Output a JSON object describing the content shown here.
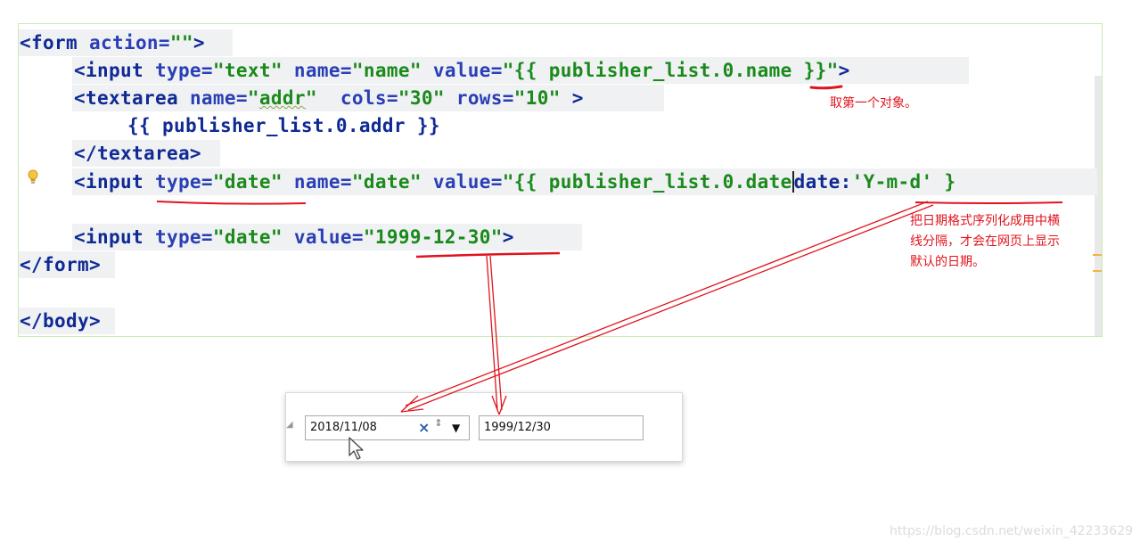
{
  "code": {
    "line1": {
      "open": "<form ",
      "attr": "action=",
      "val": "\"\"",
      "close": ">"
    },
    "line2": {
      "open": "<input ",
      "a1": "type=",
      "v1": "\"text\"",
      "a2": " name=",
      "v2": "\"name\"",
      "a3": " value=",
      "v3": "\"{{ publisher_list.0.name }}\"",
      "close": ">"
    },
    "line3": {
      "open": "<textarea ",
      "a1": "name=",
      "v1q1": "\"",
      "v1": "addr",
      "v1q2": "\"",
      "a2": "  cols=",
      "v2": "\"30\"",
      "a3": " rows=",
      "v3": "\"10\"",
      "close": " >"
    },
    "line4": {
      "text": "{{ publisher_list.0.addr }}"
    },
    "line5": {
      "text": "</textarea>"
    },
    "line6": {
      "open": "<input ",
      "a1": "type=",
      "v1": "\"date\"",
      "a2": " name=",
      "v2": "\"date\"",
      "a3": " value=",
      "v3a": "\"{{ publisher_list.0.date",
      "v3b": "date:",
      "v3c": "'Y-m-d'",
      "tail": " }"
    },
    "line7": {
      "open": "<input ",
      "a1": "type=",
      "v1": "\"date\"",
      "a2": " value=",
      "v2": "\"1999-12-30\"",
      "close": ">"
    },
    "line8": {
      "text": "</form>"
    },
    "line9": {
      "text": "</body>"
    }
  },
  "annotations": {
    "first_object": "取第一个对象。",
    "date_format_1": "把日期格式序列化成用中横",
    "date_format_2": "线分隔，才会在网页上显示",
    "date_format_3": "默认的日期。"
  },
  "rendered_inputs": {
    "date1_value": "2018/11/08",
    "clear_icon": "×",
    "spin_icon": "⇕",
    "drop_icon": "▼",
    "date2_value": "1999/12/30"
  },
  "watermark": "https://blog.csdn.net/weixin_42233629",
  "colors": {
    "annotation_red": "#e0141e",
    "tag_blue": "#0c1f8a",
    "string_green": "#1b8a1b"
  }
}
